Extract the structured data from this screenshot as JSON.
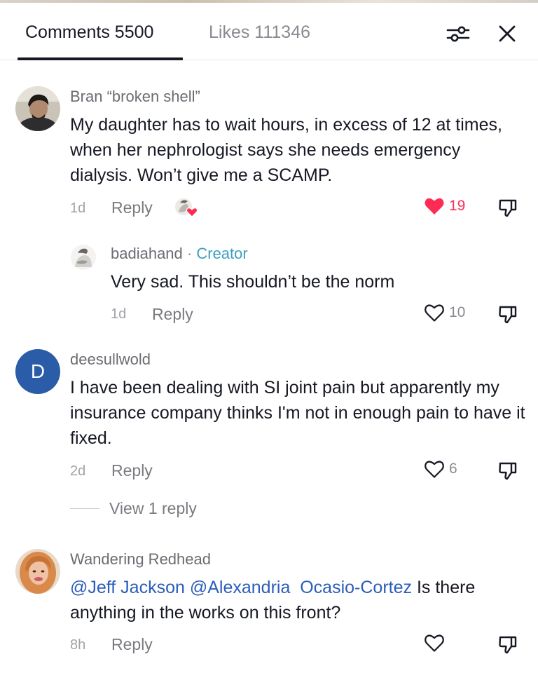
{
  "tabs": {
    "comments_label": "Comments 5500",
    "likes_label": "Likes 111346"
  },
  "icons": {
    "filter": "sliders-icon",
    "close": "close-icon",
    "like": "heart-icon",
    "dislike": "thumbs-down-icon"
  },
  "colors": {
    "liked_heart": "#fe2c55",
    "creator_tag": "#3e9fbe",
    "mention": "#2b5db9",
    "avatar_d": "#2a5ca8"
  },
  "comments": [
    {
      "username": "Bran “broken shell”",
      "text": "My daughter has to wait hours, in excess of 12 at times, when her nephrologist says she needs emergency dialysis. Won’t give me a SCAMP.",
      "time": "1d",
      "reply_label": "Reply",
      "likes": "19",
      "liked": true,
      "creator_liked": true,
      "replies": [
        {
          "username": "badiahand",
          "separator": "·",
          "tag": "Creator",
          "text": "Very sad. This shouldn’t be the norm",
          "time": "1d",
          "reply_label": "Reply",
          "likes": "10"
        }
      ]
    },
    {
      "username": "deesullwold",
      "avatar_letter": "D",
      "text": "I have been dealing with SI joint pain but apparently my insurance company thinks I'm not in enough pain to have it fixed.",
      "time": "2d",
      "reply_label": "Reply",
      "likes": "6",
      "view_replies_label": "View 1 reply"
    },
    {
      "username": "Wandering Redhead",
      "mention_1": "@Jeff Jackson",
      "mention_2": "@Alexandria  Ocasio-Cortez",
      "text_after": " Is there anything in the works on this front?",
      "time": "8h",
      "reply_label": "Reply",
      "likes": ""
    }
  ]
}
